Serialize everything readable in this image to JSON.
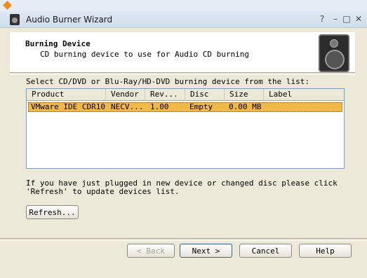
{
  "window": {
    "title": "Audio Burner Wizard",
    "controls": {
      "help": "?",
      "minimize": "–",
      "maximize": "□",
      "close": "✕"
    }
  },
  "header": {
    "title": "Burning Device",
    "subtitle": "CD burning device to use for Audio CD burning"
  },
  "prompt": "Select CD/DVD or Blu-Ray/HD-DVD burning device from the list:",
  "device_list": {
    "columns": [
      "Product",
      "Vendor",
      "Rev...",
      "Disc",
      "Size",
      "Label"
    ],
    "rows": [
      {
        "product": "VMware IDE CDR10",
        "vendor": "NECV...",
        "rev": "1.00",
        "disc": "Empty",
        "size": "0.00 MB",
        "label": ""
      }
    ],
    "selected_row_color": "#f3b84a"
  },
  "note": {
    "line1": "If you have just plugged in new device or changed disc please click",
    "line2": "'Refresh' to update devices list."
  },
  "buttons": {
    "refresh": "Refresh...",
    "back": "< Back",
    "next": "Next >",
    "cancel": "Cancel",
    "help": "Help"
  }
}
